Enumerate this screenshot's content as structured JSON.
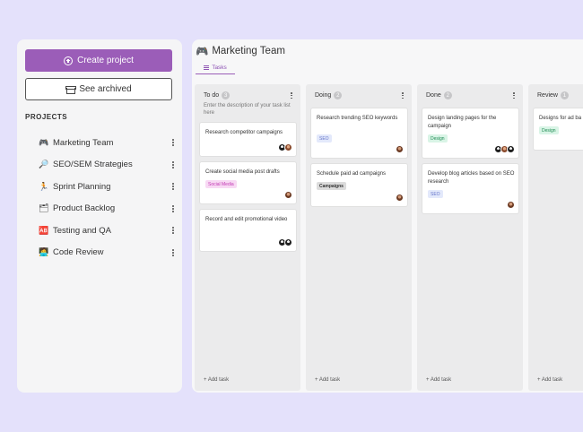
{
  "sidebar": {
    "create_label": "Create project",
    "archived_label": "See archived",
    "projects_heading": "PROJECTS",
    "projects": [
      {
        "emoji": "🎮",
        "name": "Marketing Team"
      },
      {
        "emoji": "🔎",
        "name": "SEO/SEM Strategies"
      },
      {
        "emoji": "🏃",
        "name": "Sprint Planning"
      },
      {
        "emoji": "🗂",
        "name": "Product Backlog"
      },
      {
        "emoji": "🆎",
        "name": "Testing and QA"
      },
      {
        "emoji": "🧑‍💻",
        "name": "Code Review"
      }
    ]
  },
  "main": {
    "title_emoji": "🎮",
    "title": "Marketing Team",
    "tab_label": "Tasks",
    "add_task_label": "+ Add task",
    "columns": [
      {
        "name": "To do",
        "count": "3",
        "description": "Enter the description of your task list here",
        "cards": [
          {
            "title": "Research competitor campaigns",
            "tag": ""
          },
          {
            "title": "Create social media post drafts",
            "tag": "Social Media"
          },
          {
            "title": "Record and edit promotional video",
            "tag": ""
          }
        ]
      },
      {
        "name": "Doing",
        "count": "2",
        "cards": [
          {
            "title": "Research trending SEO keywords",
            "tag": "SEO"
          },
          {
            "title": "Schedule paid ad campaigns",
            "tag": "Campaigns"
          }
        ]
      },
      {
        "name": "Done",
        "count": "2",
        "cards": [
          {
            "title": "Design landing pages for the campaign",
            "tag": "Design"
          },
          {
            "title": "Develop blog articles based on SEO research",
            "tag": "SEO"
          }
        ]
      },
      {
        "name": "Review",
        "count": "1",
        "cards": [
          {
            "title": "Designs for ad ba",
            "tag": "Design"
          }
        ]
      }
    ]
  },
  "colors": {
    "accent": "#9b5db8",
    "tag_social_media_bg": "#f8d9f4",
    "tag_social_media_text": "#c23ab3",
    "tag_seo_bg": "#e3e9fb",
    "tag_seo_text": "#6675c9",
    "tag_campaigns_bg": "#dcdcdc",
    "tag_campaigns_text": "#333333",
    "tag_design_bg": "#d9f4e6",
    "tag_design_text": "#1e8b53"
  }
}
